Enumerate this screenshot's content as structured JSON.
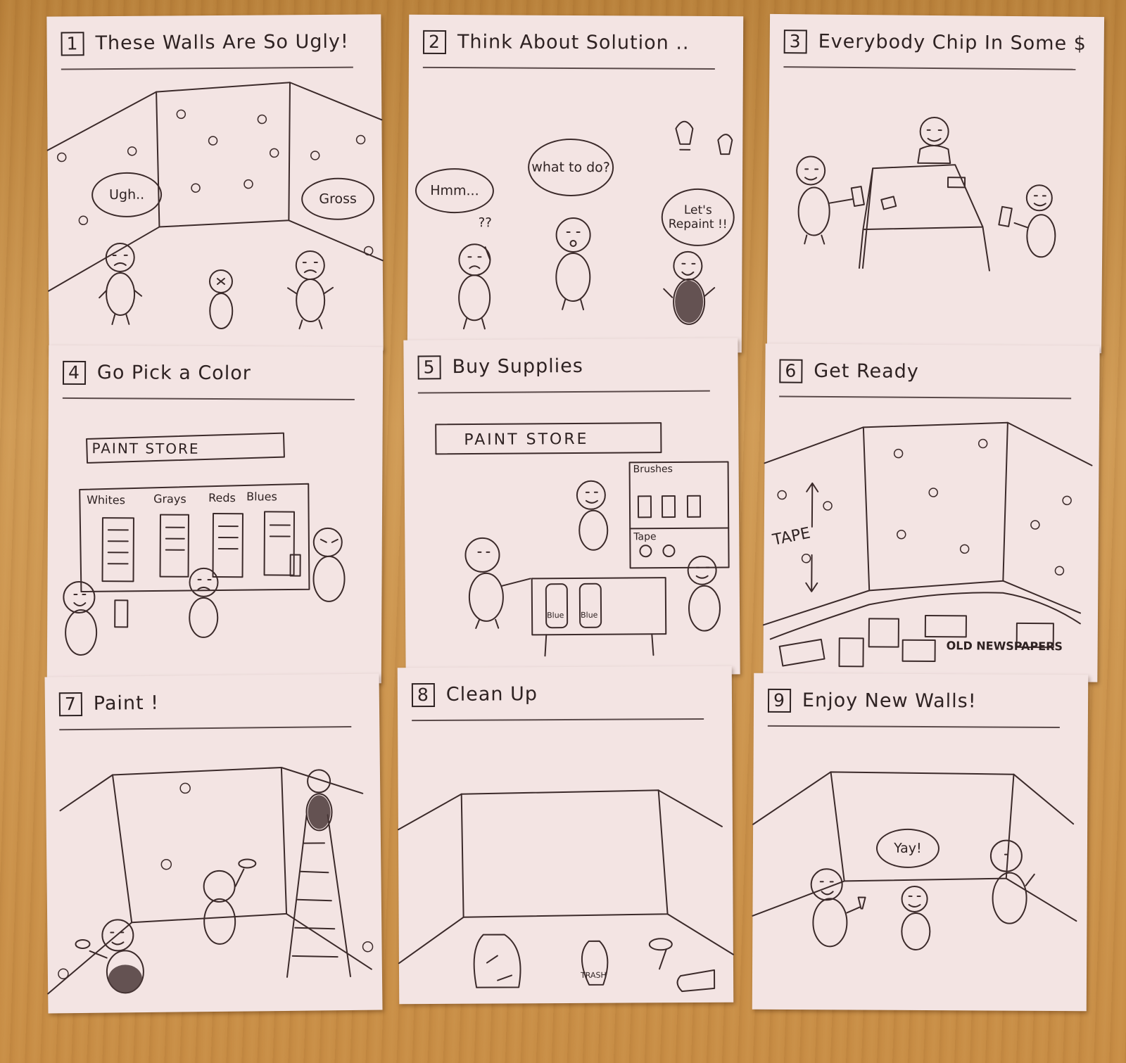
{
  "panels": [
    {
      "num": "1",
      "title": "These Walls Are So Ugly!"
    },
    {
      "num": "2",
      "title": "Think About Solution .."
    },
    {
      "num": "3",
      "title": "Everybody Chip In Some $"
    },
    {
      "num": "4",
      "title": "Go Pick a Color"
    },
    {
      "num": "5",
      "title": "Buy Supplies"
    },
    {
      "num": "6",
      "title": "Get Ready"
    },
    {
      "num": "7",
      "title": "Paint !"
    },
    {
      "num": "8",
      "title": "Clean Up"
    },
    {
      "num": "9",
      "title": "Enjoy New Walls!"
    }
  ],
  "p1": {
    "ugh": "Ugh..",
    "gross": "Gross"
  },
  "p2": {
    "hmm": "Hmm...",
    "what": "what to do?",
    "q": "??",
    "repaint": "Let's Repaint !!"
  },
  "p4": {
    "store": "PAINT STORE",
    "cats": [
      "Whites",
      "Grays",
      "Reds",
      "Blues"
    ]
  },
  "p5": {
    "store": "PAINT STORE",
    "brushes": "Brushes",
    "tape": "Tape",
    "can1": "Blue",
    "can2": "Blue"
  },
  "p6": {
    "tape": "TAPE",
    "news": "OLD NEWSPAPERS"
  },
  "p8": {
    "trash": "TRASH"
  },
  "p9": {
    "yay": "Yay!"
  }
}
